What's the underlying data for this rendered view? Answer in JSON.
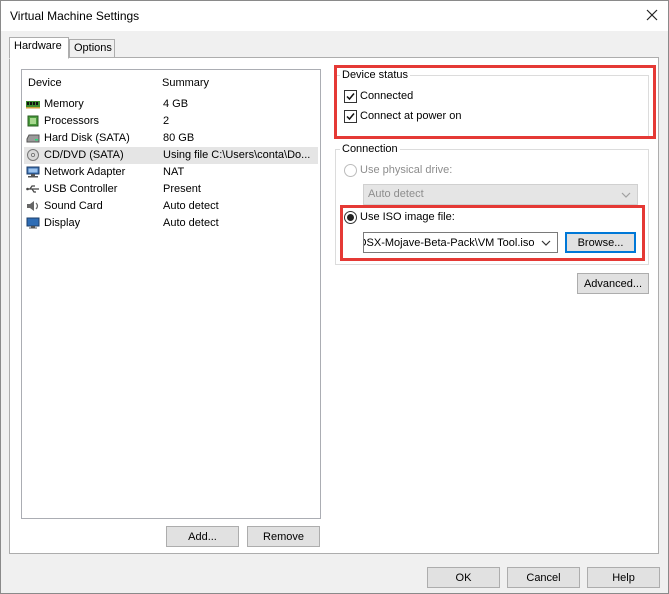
{
  "window": {
    "title": "Virtual Machine Settings"
  },
  "tabs": [
    {
      "label": "Hardware",
      "active": true
    },
    {
      "label": "Options",
      "active": false
    }
  ],
  "device_list": {
    "columns": {
      "device": "Device",
      "summary": "Summary"
    },
    "rows": [
      {
        "name": "Memory",
        "summary": "4 GB",
        "icon": "memory-icon",
        "selected": false
      },
      {
        "name": "Processors",
        "summary": "2",
        "icon": "processor-icon",
        "selected": false
      },
      {
        "name": "Hard Disk (SATA)",
        "summary": "80 GB",
        "icon": "hard-disk-icon",
        "selected": false
      },
      {
        "name": "CD/DVD (SATA)",
        "summary": "Using file C:\\Users\\conta\\Do...",
        "icon": "cd-dvd-icon",
        "selected": true
      },
      {
        "name": "Network Adapter",
        "summary": "NAT",
        "icon": "network-icon",
        "selected": false
      },
      {
        "name": "USB Controller",
        "summary": "Present",
        "icon": "usb-icon",
        "selected": false
      },
      {
        "name": "Sound Card",
        "summary": "Auto detect",
        "icon": "sound-icon",
        "selected": false
      },
      {
        "name": "Display",
        "summary": "Auto detect",
        "icon": "display-icon",
        "selected": false
      }
    ],
    "add_label": "Add...",
    "remove_label": "Remove"
  },
  "device_status": {
    "label": "Device status",
    "connected": {
      "label": "Connected",
      "checked": true
    },
    "connect_power_on": {
      "label": "Connect at power on",
      "checked": true
    }
  },
  "connection": {
    "label": "Connection",
    "physical": {
      "label": "Use physical drive:",
      "selected": false,
      "enabled": false
    },
    "physical_value": "Auto detect",
    "iso": {
      "label": "Use ISO image file:",
      "selected": true
    },
    "iso_value": "OSX-Mojave-Beta-Pack\\VM Tool.iso",
    "browse_label": "Browse...",
    "advanced_label": "Advanced..."
  },
  "footer": {
    "ok_label": "OK",
    "cancel_label": "Cancel",
    "help_label": "Help"
  },
  "colors": {
    "highlight": "#e53935",
    "focus": "#0078d7"
  }
}
